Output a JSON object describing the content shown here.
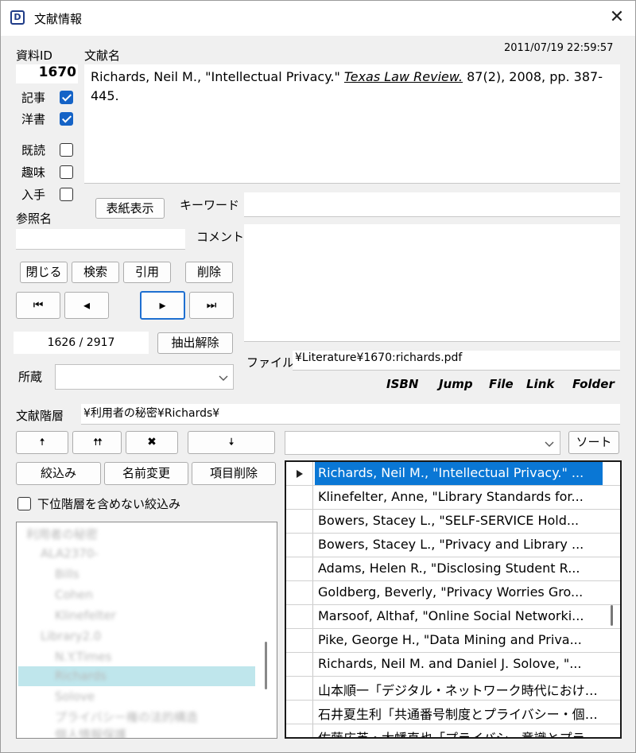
{
  "window": {
    "title": "文献情報",
    "icon_letter": "D"
  },
  "timestamp": "2011/07/19 22:59:57",
  "left": {
    "id_label": "資料ID",
    "id_value": "1670",
    "checks": [
      {
        "label": "記事",
        "checked": true
      },
      {
        "label": "洋書",
        "checked": true
      },
      {
        "label": "既読",
        "checked": false
      },
      {
        "label": "趣味",
        "checked": false
      },
      {
        "label": "入手",
        "checked": false
      }
    ],
    "ref_name_label": "参照名",
    "ref_name_value": "",
    "cover_button": "表紙表示",
    "buttons": {
      "close": "閉じる",
      "search": "検索",
      "cite": "引用",
      "delete": "削除"
    },
    "nav": {
      "first": "⏮",
      "prev": "◂",
      "next": "▸",
      "last": "⏭"
    },
    "counter": "1626 / 2917",
    "extract_clear": "抽出解除",
    "holding_label": "所蔵",
    "holding_value": ""
  },
  "main": {
    "title_label": "文献名",
    "citation_part1": "Richards, Neil M., \"Intellectual Privacy.\" ",
    "citation_journal": "Texas Law Review.",
    "citation_part2": " 87(2), 2008, pp. 387-445.",
    "keyword_label": "キーワード",
    "keyword_value": "",
    "comment_label": "コメント",
    "comment_value": "",
    "file_label": "ファイル",
    "file_value": "¥Literature¥1670:richards.pdf",
    "links": [
      "ISBN",
      "Jump",
      "File",
      "Link",
      "Folder"
    ]
  },
  "hierarchy": {
    "label": "文献階層",
    "value": "¥利用者の秘密¥Richards¥",
    "move_buttons": {
      "up": "🠅",
      "top": "🠅🠅",
      "remove": "✖",
      "down": "🠇"
    },
    "sort_button": "ソート",
    "sort_value": "",
    "filter_button": "絞込み",
    "rename_button": "名前変更",
    "delete_item_button": "項目削除",
    "exclude_sub_label": "下位階層を含めない絞込み",
    "exclude_sub_checked": false
  },
  "tree": {
    "nodes": [
      "利用者の秘密",
      "ALA2370-",
      "Bills",
      "Cohen",
      "Klinefelter",
      "Library2.0",
      "N.Y.Times",
      "Richards",
      "Solove",
      "プライバシー権の法的構造",
      "個人情報保護"
    ]
  },
  "grid": {
    "rows": [
      "Richards, Neil M., \"Intellectual Privacy.\" ...",
      "Klinefelter, Anne, \"Library Standards for...",
      "Bowers, Stacey L., \"SELF-SERVICE Hold...",
      "Bowers, Stacey L., \"Privacy and Library ...",
      "Adams, Helen R., \"Disclosing Student R...",
      "Goldberg, Beverly, \"Privacy Worries Gro...",
      "Marsoof, Althaf, \"Online Social Networki...",
      "Pike, George H., \"Data Mining and Priva...",
      "Richards, Neil M. and Daniel J. Solove, \"...",
      "山本順一「デジタル・ネットワーク時代におけるプラ...",
      "石井夏生利「共通番号制度とプライバシー・個人...",
      "佐藤広英・太幡直也「プライバシー意識とプライバ"
    ],
    "selected_index": 0
  },
  "colors": {
    "accent": "#0a77d5",
    "checkbox": "#1563c6",
    "tree_selected": "#bfe6ec"
  }
}
